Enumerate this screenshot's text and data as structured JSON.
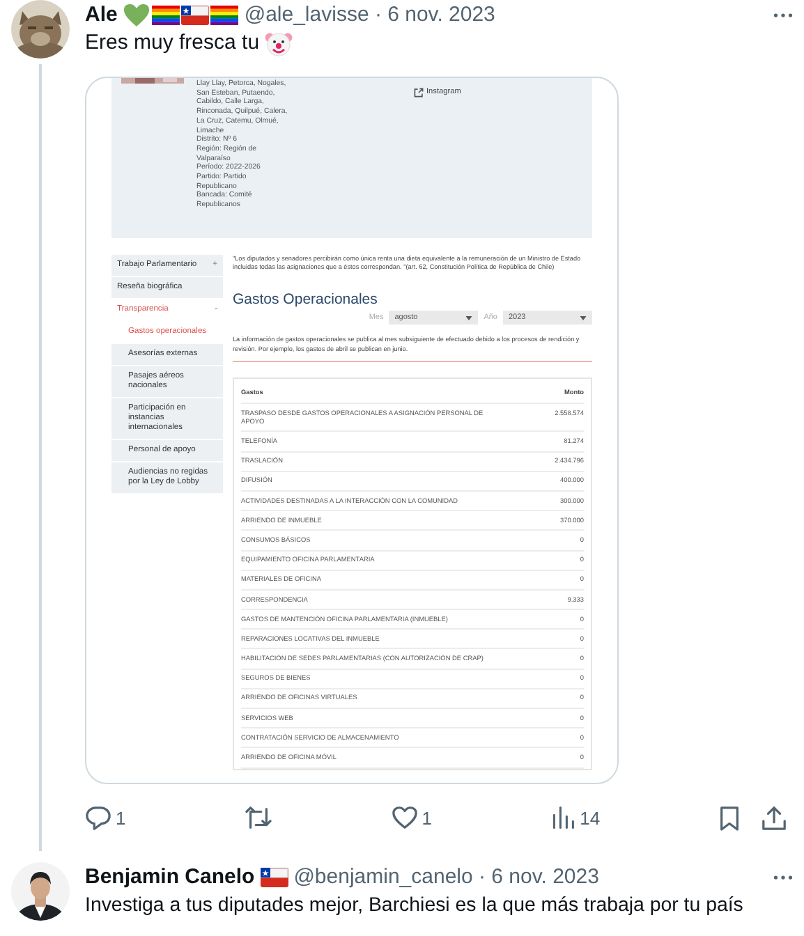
{
  "tweets": [
    {
      "author": "Ale",
      "badges": [
        {
          "kind": "heart"
        },
        {
          "kind": "rainbow_flag"
        },
        {
          "kind": "chile_flag"
        },
        {
          "kind": "rainbow_flag"
        }
      ],
      "meta": "@ale_lavisse · 6 nov. 2023",
      "text": "Eres muy fresca tu",
      "emoji": {
        "kind": "clown"
      },
      "attachment": {
        "profile_lines": [
          "Llay Llay, Petorca, Nogales,",
          "San Esteban, Putaendo,",
          "Cabildo, Calle Larga,",
          "Rinconada, Quilpué, Calera,",
          "La Cruz, Catemu, Olmué,",
          "Limache",
          "Distrito: Nº 6",
          "Región: Región de",
          "Valparaíso",
          "Período: 2022-2026",
          "Partido: Partido",
          "Republicano",
          "Bancada: Comité",
          "Republicanos"
        ],
        "social_link": "Instagram",
        "sidebar": [
          {
            "label": "Trabajo Parlamentario",
            "toggle": "+",
            "selected": false
          },
          {
            "label": "Reseña biográfica",
            "selected": false
          },
          {
            "label": "Transparencia",
            "toggle": "-",
            "selected": true,
            "children": [
              {
                "label": "Gastos operacionales",
                "selected": true
              },
              {
                "label": "Asesorías externas",
                "selected": false
              },
              {
                "label": "Pasajes aéreos nacionales",
                "selected": false
              },
              {
                "label": "Participación en instancias internacionales",
                "selected": false
              },
              {
                "label": "Personal de apoyo",
                "selected": false
              },
              {
                "label": "Audiencias no regidas por la Ley de Lobby",
                "selected": false
              }
            ]
          }
        ],
        "quote": "\"Los diputados y senadores percibirán como única renta una dieta equivalente a la remuneración de un Ministro de Estado incluidas todas las asignaciones que a éstos correspondan. \"(art. 62, Constitución Política de República de Chile)",
        "heading": "Gastos Operacionales",
        "filters": [
          {
            "label": "Mes",
            "value": "agosto"
          },
          {
            "label": "Año",
            "value": "2023"
          }
        ],
        "note": "La información de gastos operacionales se publica al mes subsiguiente de efectuado debido a los procesos de rendición y revisión. Por ejemplo, los gastos de abril se publican en junio.",
        "table": {
          "columns": [
            "Gastos",
            "Monto"
          ],
          "rows": [
            [
              "TRASPASO DESDE GASTOS OPERACIONALES A ASIGNACIÓN PERSONAL DE APOYO",
              "2.558.574"
            ],
            [
              "TELEFONÍA",
              "81.274"
            ],
            [
              "TRASLACIÓN",
              "2.434.796"
            ],
            [
              "DIFUSIÓN",
              "400.000"
            ],
            [
              "ACTIVIDADES DESTINADAS A LA INTERACCIÓN CON LA COMUNIDAD",
              "300.000"
            ],
            [
              "ARRIENDO DE INMUEBLE",
              "370.000"
            ],
            [
              "CONSUMOS BÁSICOS",
              "0"
            ],
            [
              "EQUIPAMIENTO OFICINA PARLAMENTARIA",
              "0"
            ],
            [
              "MATERIALES DE OFICINA",
              "0"
            ],
            [
              "CORRESPONDENCIA",
              "9.333"
            ],
            [
              "GASTOS DE MANTENCIÓN OFICINA PARLAMENTARIA (INMUEBLE)",
              "0"
            ],
            [
              "REPARACIONES LOCATIVAS DEL INMUEBLE",
              "0"
            ],
            [
              "HABILITACIÓN DE SEDES PARLAMENTARIAS (CON AUTORIZACIÓN DE CRAP)",
              "0"
            ],
            [
              "SEGUROS DE BIENES",
              "0"
            ],
            [
              "ARRIENDO DE OFICINAS VIRTUALES",
              "0"
            ],
            [
              "SERVICIOS WEB",
              "0"
            ],
            [
              "CONTRATACIÓN SERVICIO DE ALMACENAMIENTO",
              "0"
            ],
            [
              "ARRIENDO DE OFICINA MÓVIL",
              "0"
            ]
          ]
        }
      },
      "actions": [
        {
          "kind": "reply",
          "count": "1"
        },
        {
          "kind": "repost"
        },
        {
          "kind": "like",
          "count": "1"
        },
        {
          "kind": "views",
          "count": "14"
        },
        {
          "kind": "bookmark"
        },
        {
          "kind": "share"
        }
      ]
    },
    {
      "author": "Benjamin Canelo",
      "badges": [
        {
          "kind": "chile_flag"
        }
      ],
      "meta": "@benjamin_canelo · 6 nov. 2023",
      "text": "Investiga a tus diputades mejor, Barchiesi es la que más trabaja por tu país"
    }
  ]
}
